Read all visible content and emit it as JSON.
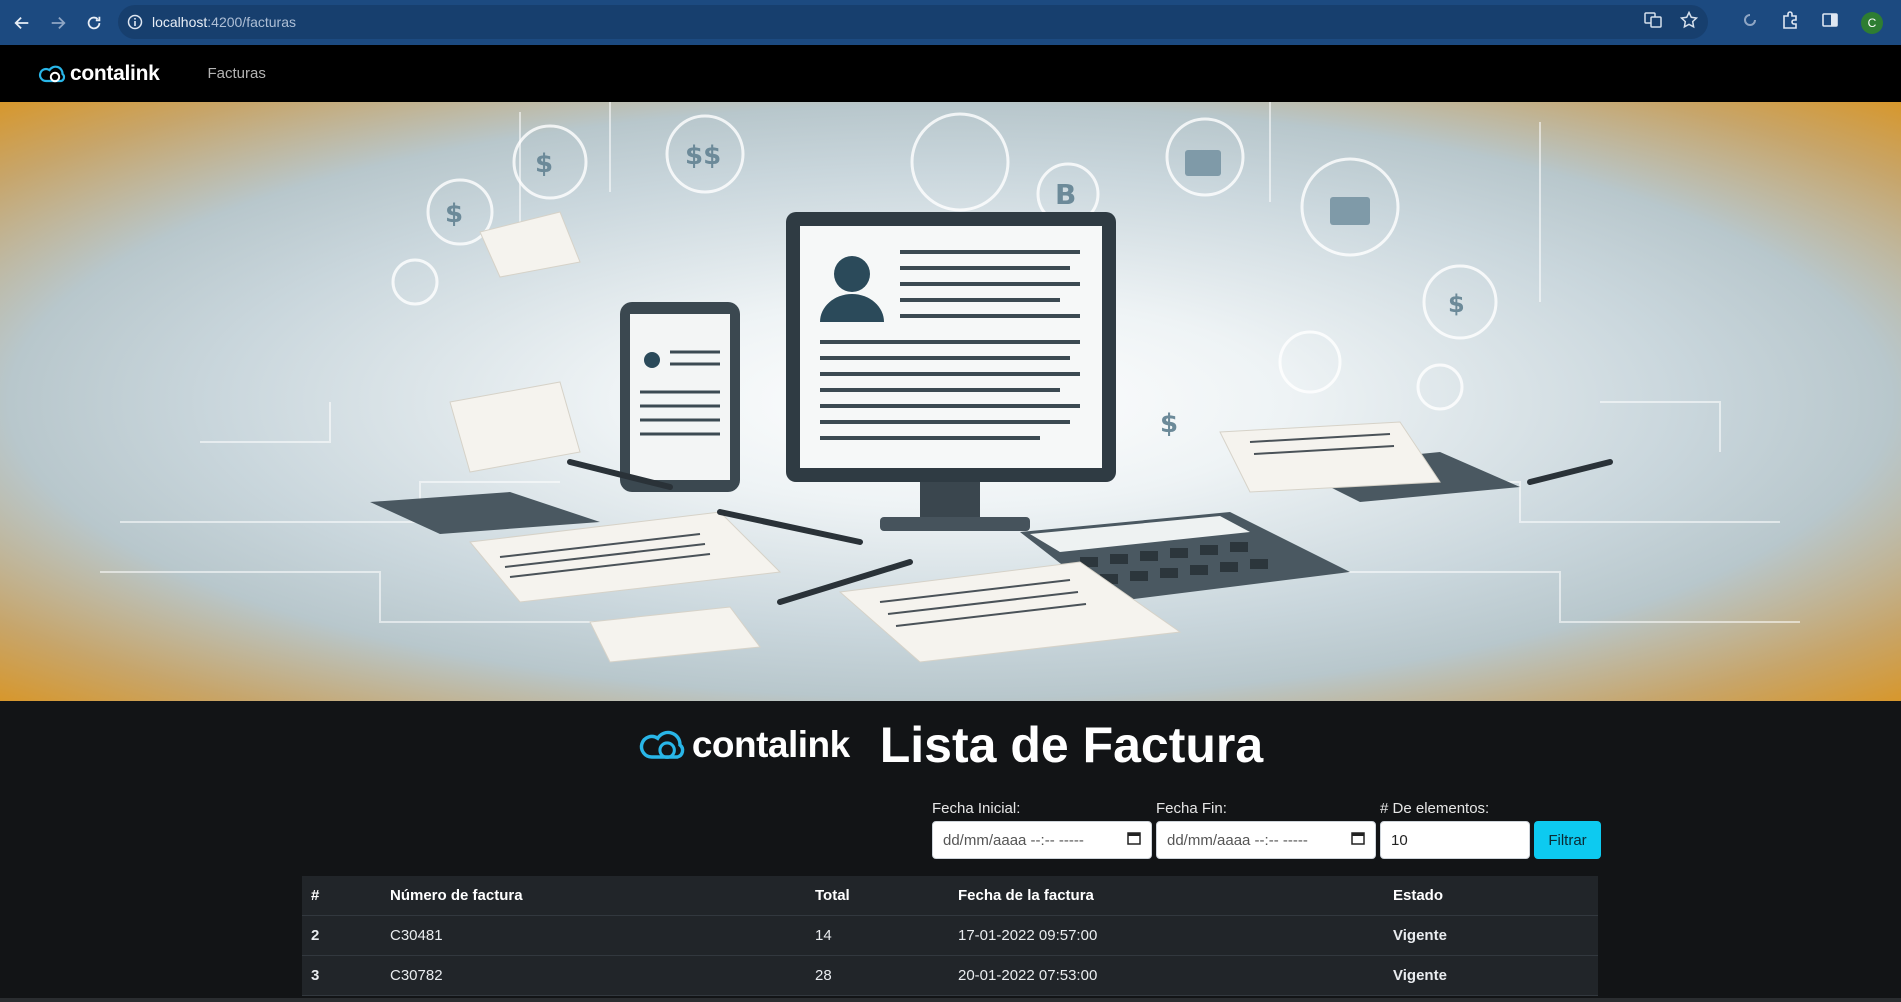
{
  "browser": {
    "url_host": "localhost",
    "url_path": ":4200/facturas",
    "profile_initial": "C"
  },
  "navbar": {
    "brand": "contalink",
    "links": [
      "Facturas"
    ]
  },
  "main": {
    "brand": "contalink",
    "title": "Lista de Factura",
    "filters": {
      "start_label": "Fecha Inicial:",
      "start_placeholder": "dd/mm/aaaa --:-- -----",
      "end_label": "Fecha Fin:",
      "end_placeholder": "dd/mm/aaaa --:-- -----",
      "count_label": "# De elementos:",
      "count_value": "10",
      "button": "Filtrar"
    },
    "table": {
      "columns": [
        "#",
        "Número de factura",
        "Total",
        "Fecha de la factura",
        "Estado"
      ],
      "rows": [
        [
          "2",
          "C30481",
          "14",
          "17-01-2022 09:57:00",
          "Vigente"
        ],
        [
          "3",
          "C30782",
          "28",
          "20-01-2022 07:53:00",
          "Vigente"
        ]
      ]
    }
  },
  "colors": {
    "accent": "#0dcaf0",
    "chrome": "#1c4a80",
    "logo": "#29b6e8"
  }
}
